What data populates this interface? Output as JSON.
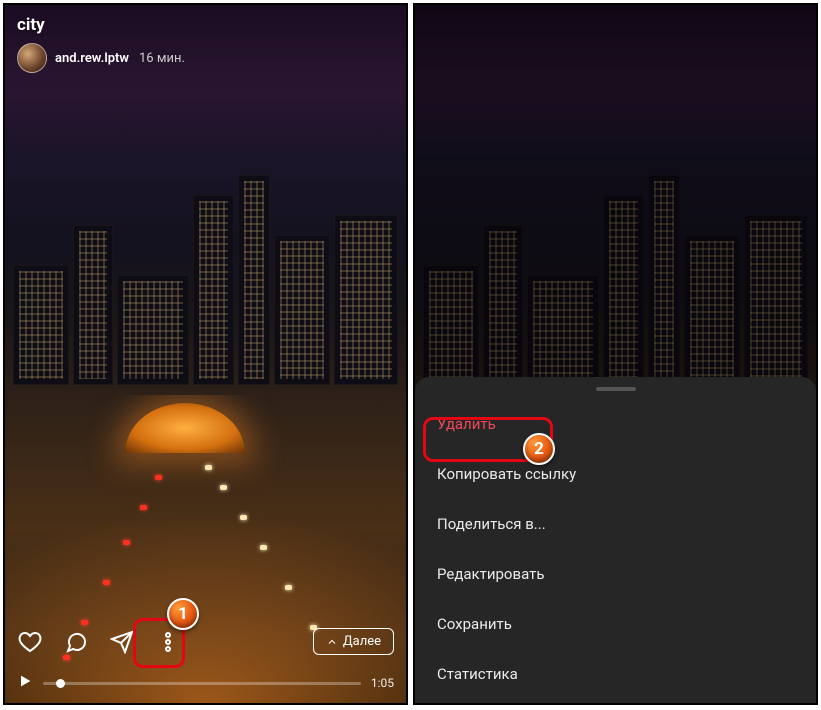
{
  "left": {
    "title": "city",
    "username": "and.rew.lptw",
    "timestamp": "16 мин.",
    "next_label": "Далее",
    "duration": "1:05",
    "badge": "1"
  },
  "right": {
    "badge": "2",
    "menu": {
      "delete": "Удалить",
      "copy_link": "Копировать ссылку",
      "share": "Поделиться в...",
      "edit": "Редактировать",
      "save": "Сохранить",
      "stats": "Статистика"
    }
  }
}
